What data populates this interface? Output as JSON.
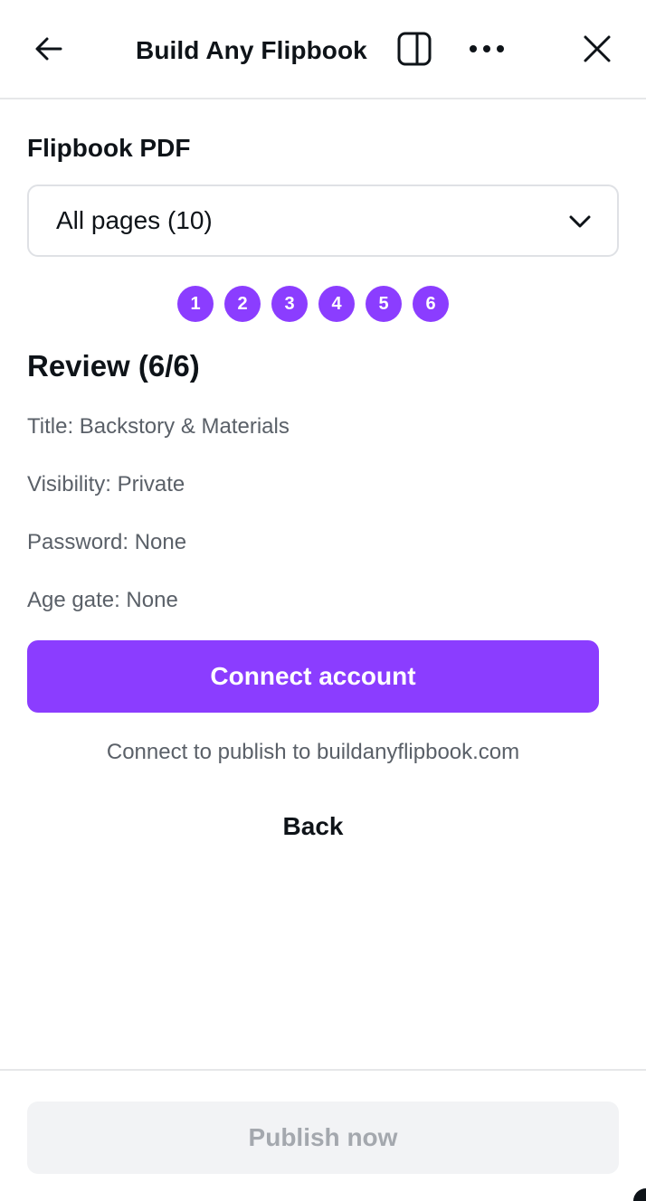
{
  "header": {
    "title": "Build Any Flipbook",
    "icons": {
      "back": "arrow-left-icon",
      "panel": "split-panel-icon",
      "more": "more-horizontal-icon",
      "close": "close-icon"
    }
  },
  "flipbook": {
    "label": "Flipbook PDF",
    "select_value": "All pages (10)"
  },
  "steps": [
    "1",
    "2",
    "3",
    "4",
    "5",
    "6"
  ],
  "review": {
    "heading": "Review (6/6)",
    "title": "Title: Backstory & Materials",
    "visibility": "Visibility: Private",
    "password": "Password: None",
    "age_gate": "Age gate: None"
  },
  "actions": {
    "connect_label": "Connect account",
    "connect_hint": "Connect to publish to buildanyflipbook.com",
    "back_label": "Back"
  },
  "footer": {
    "publish_label": "Publish now"
  },
  "colors": {
    "accent": "#8b3dff",
    "text": "#0e1318",
    "muted": "#5a6068",
    "disabled_bg": "#f2f3f5",
    "disabled_text": "#a4a8ae"
  }
}
